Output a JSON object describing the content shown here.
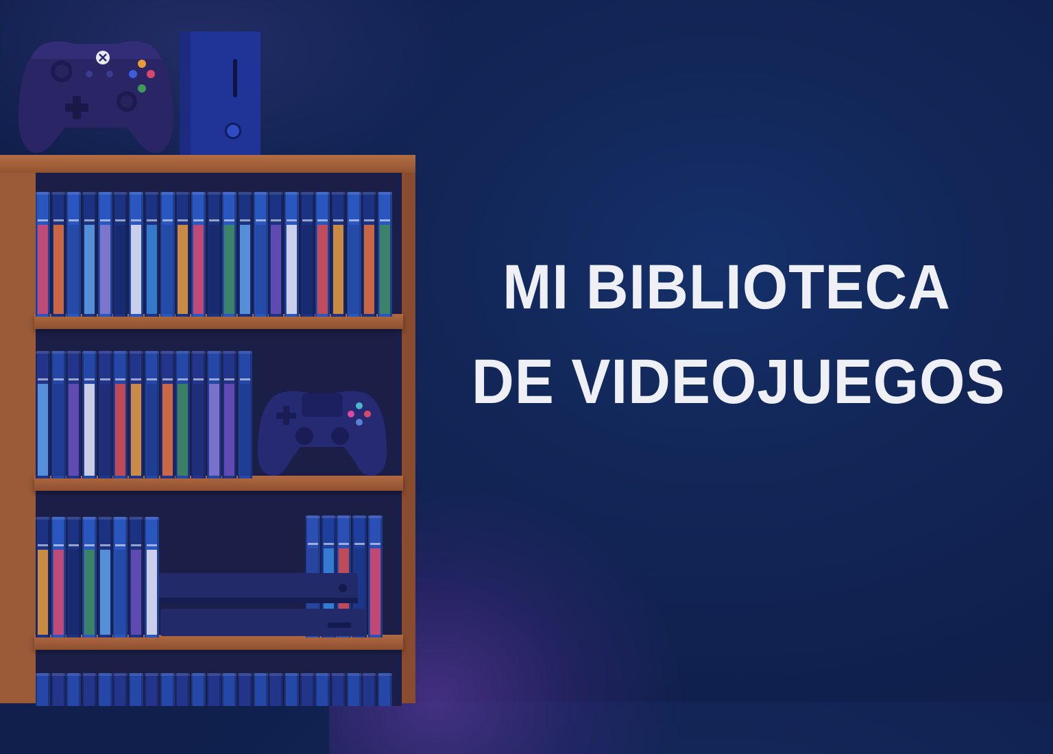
{
  "title": {
    "line1": "MI BIBLIOTECA",
    "line2": "DE VIDEOJUEGOS"
  },
  "colors": {
    "background": "#122657",
    "title_text": "#eef0f6",
    "shelf_wood": "#9b5a38",
    "case_accents": [
      "#3a86d8",
      "#d9476a",
      "#5fa0e8",
      "#e9e4f2",
      "#e89a3a",
      "#3f8a58",
      "#6a4fb8",
      "#d94a4a",
      "#e8703a",
      "#8a7ad0"
    ]
  },
  "icons": [
    "xbox-controller-icon",
    "playstation-controller-icon",
    "console-tower-icon",
    "console-flat-icon",
    "bookshelf-icon"
  ]
}
